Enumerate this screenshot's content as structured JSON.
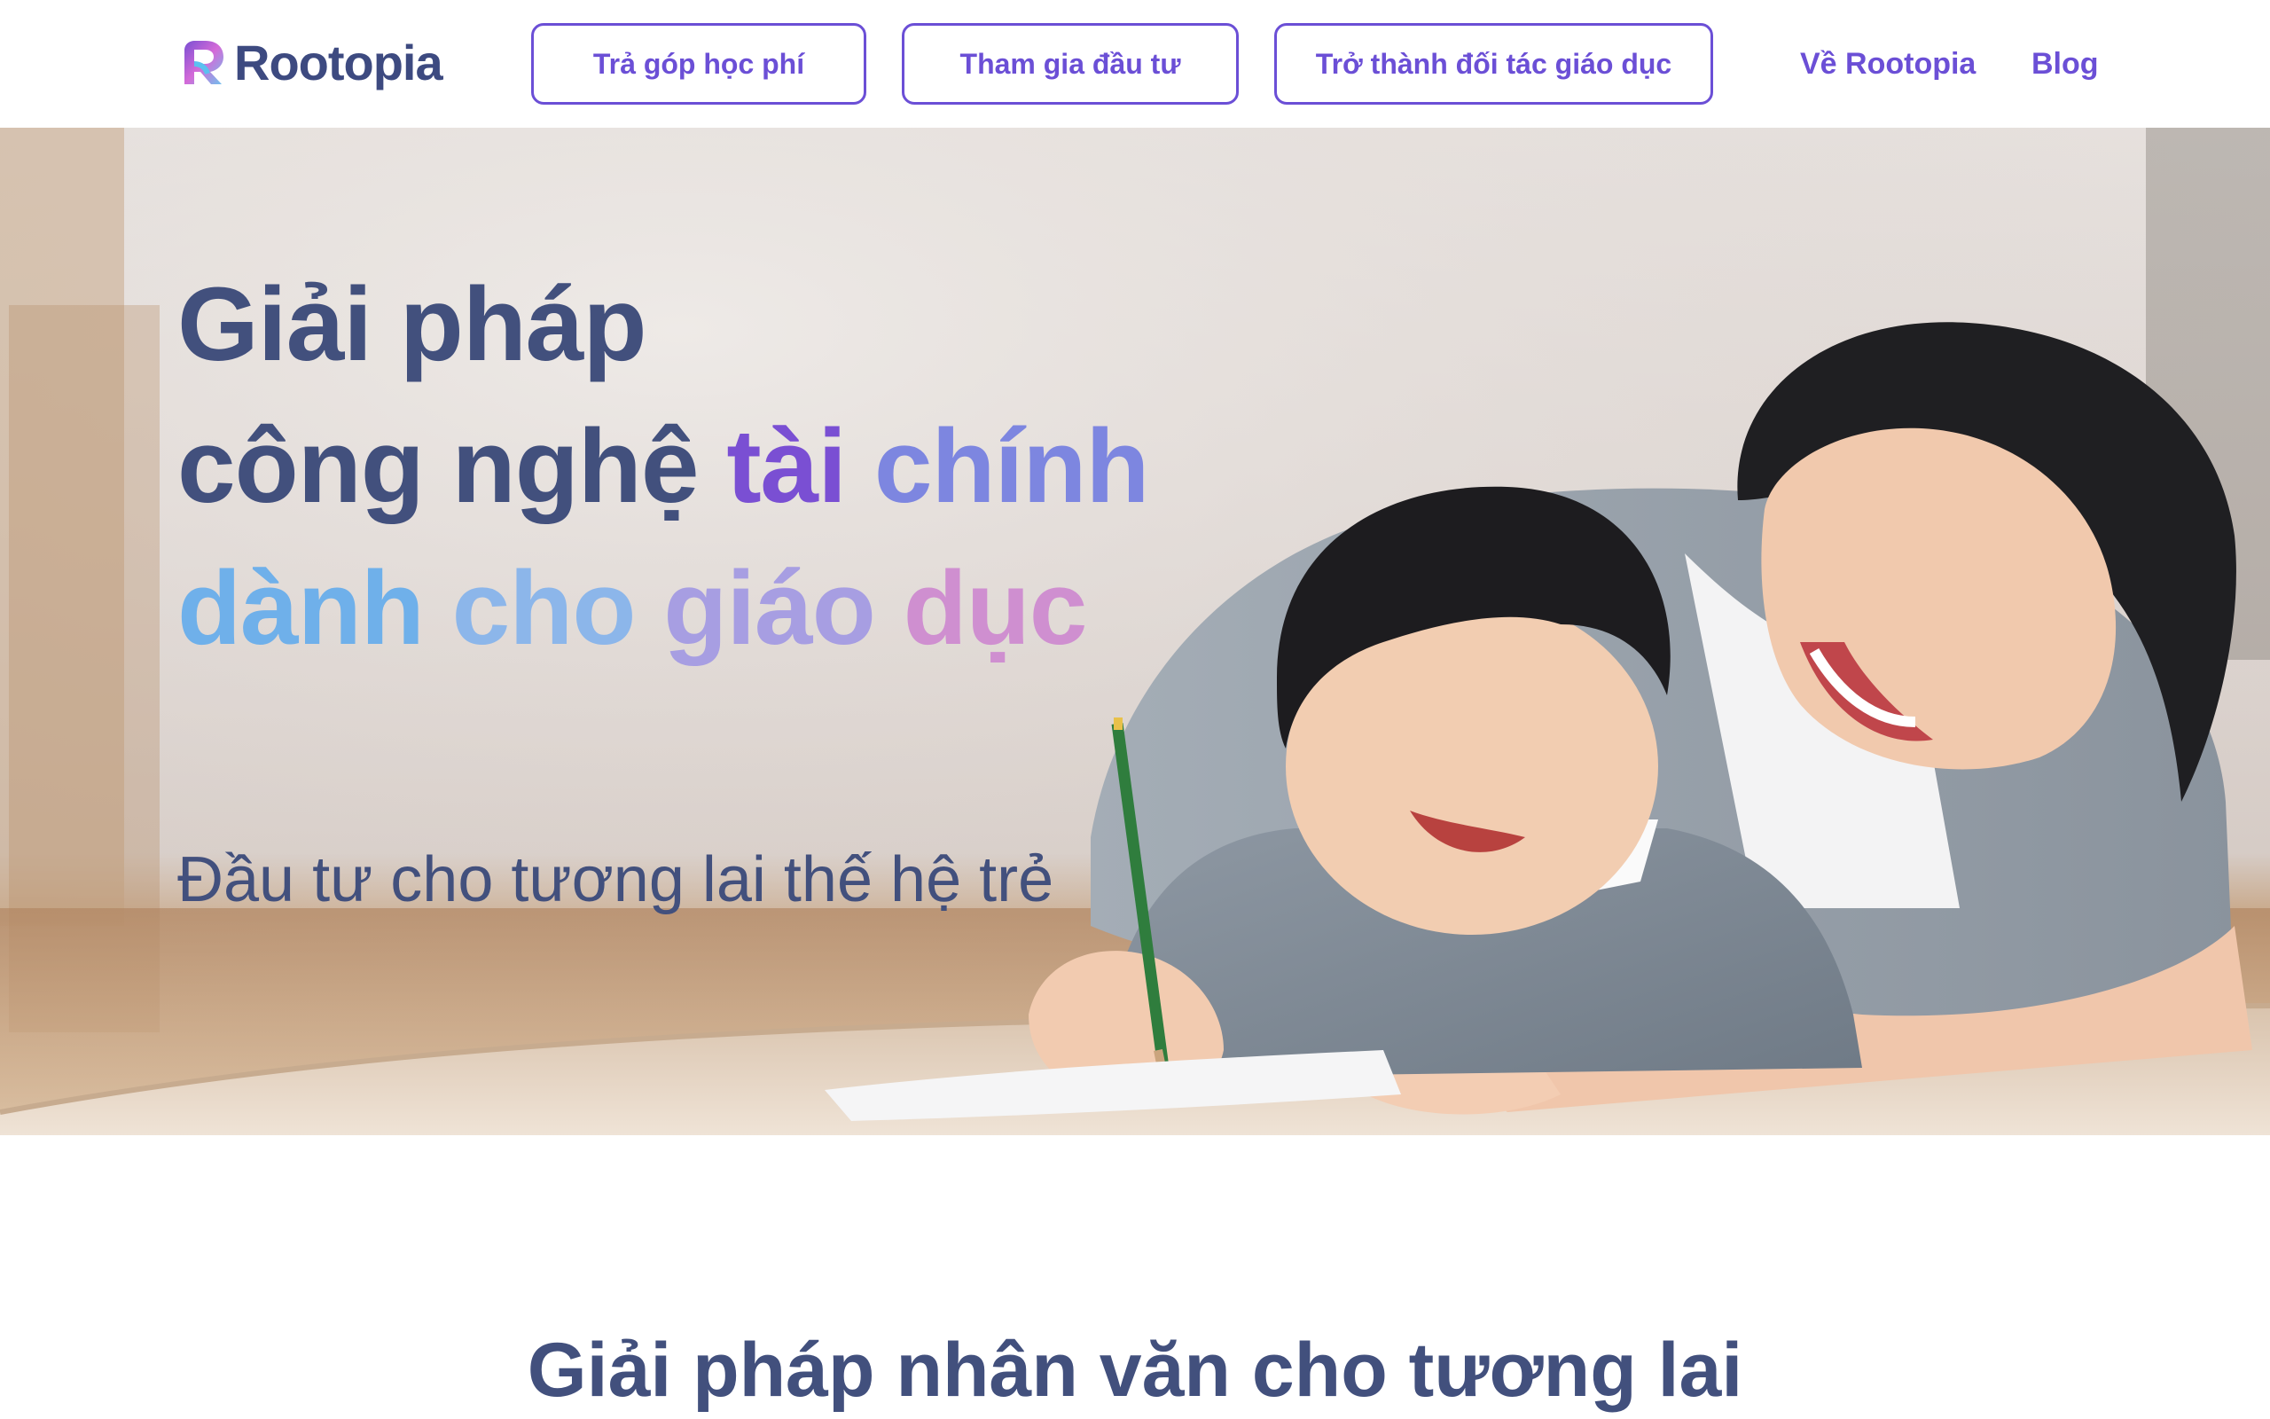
{
  "header": {
    "logo_text": "Rootopia",
    "buttons": [
      {
        "label": "Trả góp học phí"
      },
      {
        "label": "Tham gia đầu tư"
      },
      {
        "label": "Trở thành đối tác giáo dục"
      }
    ],
    "links": [
      {
        "label": "Về Rootopia"
      },
      {
        "label": "Blog"
      }
    ]
  },
  "hero": {
    "headline": {
      "line1": "Giải pháp",
      "line2_plain": "công nghệ",
      "line2_accent_1": "tài",
      "line2_accent_2": "chính",
      "line3_word_1": "dành",
      "line3_word_2": "cho",
      "line3_word_3": "giáo",
      "line3_word_4": "dục"
    },
    "subheadline": "Đầu tư cho tương lai thế hệ trẻ",
    "image_icon": "mother-child-writing-photo"
  },
  "section": {
    "title": "Giải pháp nhân văn cho tương lai"
  },
  "colors": {
    "primary": "#6b4fd6",
    "text_dark": "#42507d",
    "accent_purple": "#7a4fd3",
    "accent_blue": "#6fb0ea",
    "accent_pink": "#cf8fd0"
  }
}
